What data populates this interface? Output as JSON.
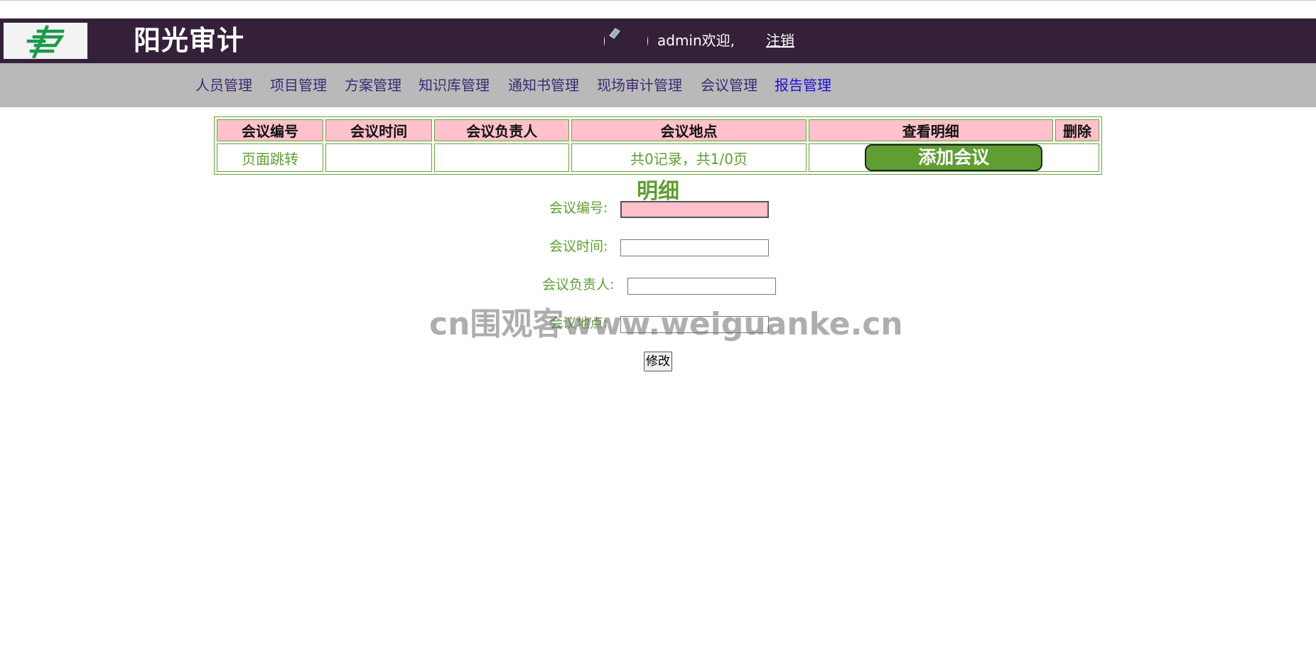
{
  "header": {
    "title": "阳光审计",
    "welcome": "admin欢迎,",
    "logout": "注销",
    "logo_icon": "china-post-logo-icon",
    "avatar_icon": "user-avatar-icon",
    "colors": {
      "bar": "#35203a",
      "logo_green": "#1a9a4a"
    }
  },
  "nav": {
    "items": [
      {
        "label": "人员管理"
      },
      {
        "label": "项目管理"
      },
      {
        "label": "方案管理"
      },
      {
        "label": "知识库管理"
      },
      {
        "label": "通知书管理"
      },
      {
        "label": "现场审计管理"
      },
      {
        "label": "会议管理"
      },
      {
        "label": "报告管理"
      }
    ],
    "active_index": 7
  },
  "table": {
    "headers": [
      "会议编号",
      "会议时间",
      "会议负责人",
      "会议地点",
      "查看明细",
      "删除"
    ],
    "footer": {
      "jump_label": "页面跳转",
      "record_info": "共0记录，共1/0页",
      "add_button": "添加会议"
    }
  },
  "detail": {
    "title": "明细",
    "fields": [
      {
        "label": "会议编号:",
        "value": ""
      },
      {
        "label": "会议时间:",
        "value": ""
      },
      {
        "label": "会议负责人:",
        "value": ""
      },
      {
        "label": "会议地点:",
        "value": ""
      }
    ],
    "submit_label": "修改"
  },
  "watermark": "cn围观客www.weiguanke.cn",
  "colors": {
    "accent_green": "#5f9e32",
    "header_pink": "#ffc1cb",
    "nav_bg": "#b9b9b9"
  }
}
